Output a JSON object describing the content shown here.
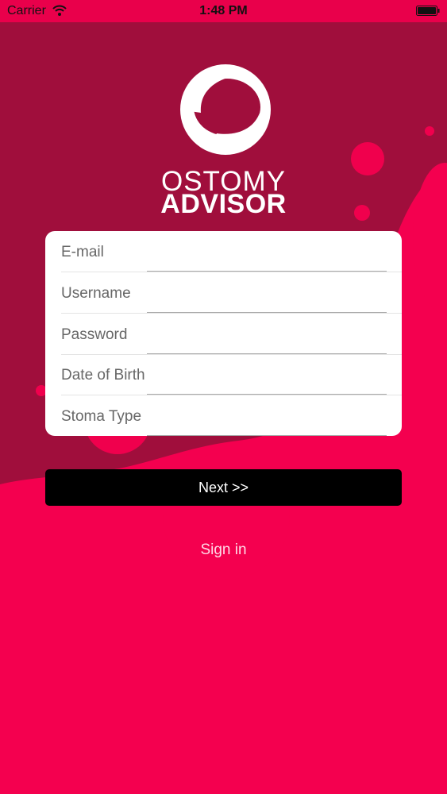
{
  "status_bar": {
    "carrier": "Carrier",
    "time": "1:48 PM"
  },
  "brand": {
    "line1": "OSTOMY",
    "line2": "ADVISOR"
  },
  "form": {
    "fields": [
      {
        "label": "E-mail",
        "value": ""
      },
      {
        "label": "Username",
        "value": ""
      },
      {
        "label": "Password",
        "value": ""
      },
      {
        "label": "Date of Birth",
        "value": ""
      },
      {
        "label": "Stoma Type",
        "value": ""
      }
    ]
  },
  "actions": {
    "next_label": "Next >>",
    "signin_label": "Sign in"
  },
  "colors": {
    "primary": "#f4004f",
    "dark": "#a00e3c",
    "button": "#000000"
  }
}
